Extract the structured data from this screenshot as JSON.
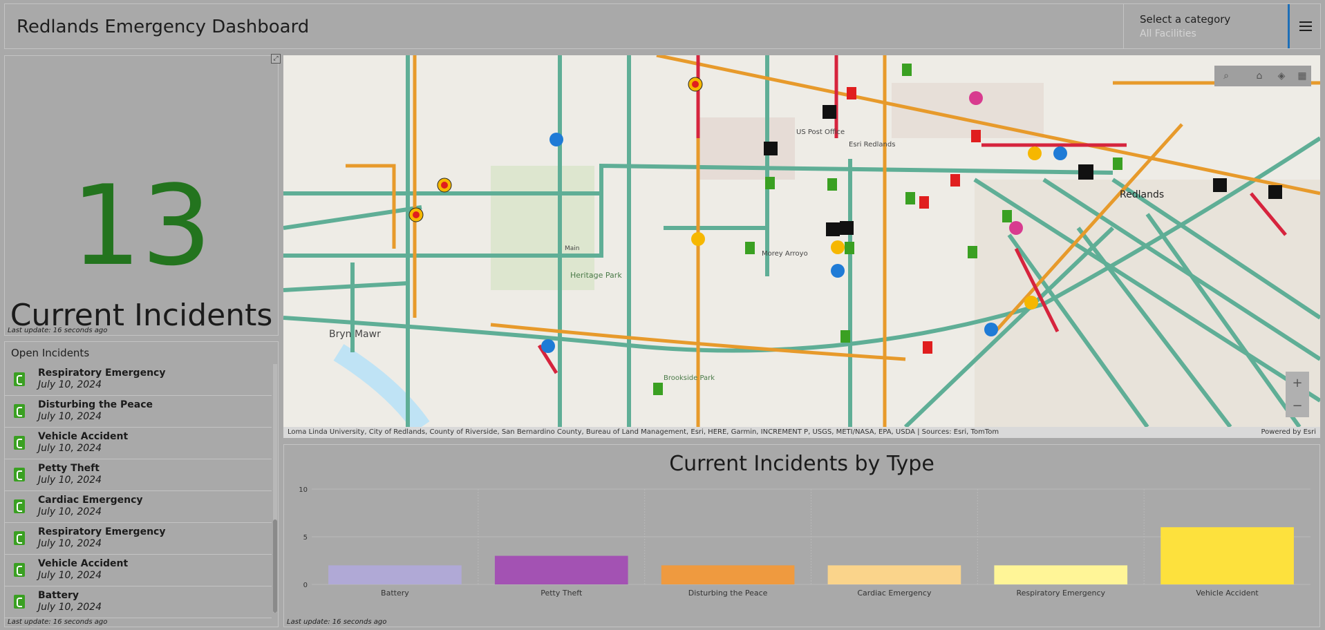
{
  "header": {
    "title": "Redlands Emergency Dashboard",
    "category_label": "Select a category",
    "category_value": "All Facilities",
    "menu_icon": "hamburger-menu-icon"
  },
  "indicator": {
    "value": "13",
    "caption": "Current Incidents",
    "last_update": "Last update: 16 seconds ago"
  },
  "incidents": {
    "title": "Open Incidents",
    "last_update": "Last update: 16 seconds ago",
    "items": [
      {
        "name": "Respiratory Emergency",
        "date": "July 10, 2024"
      },
      {
        "name": "Disturbing the Peace",
        "date": "July 10, 2024"
      },
      {
        "name": "Vehicle Accident",
        "date": "July 10, 2024"
      },
      {
        "name": "Petty Theft",
        "date": "July 10, 2024"
      },
      {
        "name": "Cardiac Emergency",
        "date": "July 10, 2024"
      },
      {
        "name": "Respiratory Emergency",
        "date": "July 10, 2024"
      },
      {
        "name": "Vehicle Accident",
        "date": "July 10, 2024"
      },
      {
        "name": "Battery",
        "date": "July 10, 2024"
      }
    ]
  },
  "map": {
    "labels": [
      "Bryn Mawr",
      "Heritage Park",
      "Brookside Park",
      "Redlands",
      "Esri Redlands",
      "US Post Office",
      "Morey Arroyo",
      "Main"
    ],
    "attribution": "Loma Linda University, City of Redlands, County of Riverside, San Bernardino County, Bureau of Land Management, Esri, HERE, Garmin, INCREMENT P, USGS, METI/NASA, EPA, USDA | Sources: Esri, TomTom",
    "powered_by": "Powered by Esri",
    "zoom_in": "+",
    "zoom_out": "−"
  },
  "chart": {
    "last_update": "Last update: 16 seconds ago"
  },
  "chart_data": {
    "type": "bar",
    "title": "Current Incidents by Type",
    "categories": [
      "Battery",
      "Petty Theft",
      "Disturbing the Peace",
      "Cardiac Emergency",
      "Respiratory Emergency",
      "Vehicle Accident"
    ],
    "values": [
      2,
      3,
      2,
      2,
      2,
      6
    ],
    "colors": [
      "#b0a9d6",
      "#a352b3",
      "#ef9a3f",
      "#fad48b",
      "#fff597",
      "#fde13d"
    ],
    "ylim": [
      0,
      10
    ],
    "yticks": [
      0,
      5,
      10
    ],
    "grid": true
  }
}
